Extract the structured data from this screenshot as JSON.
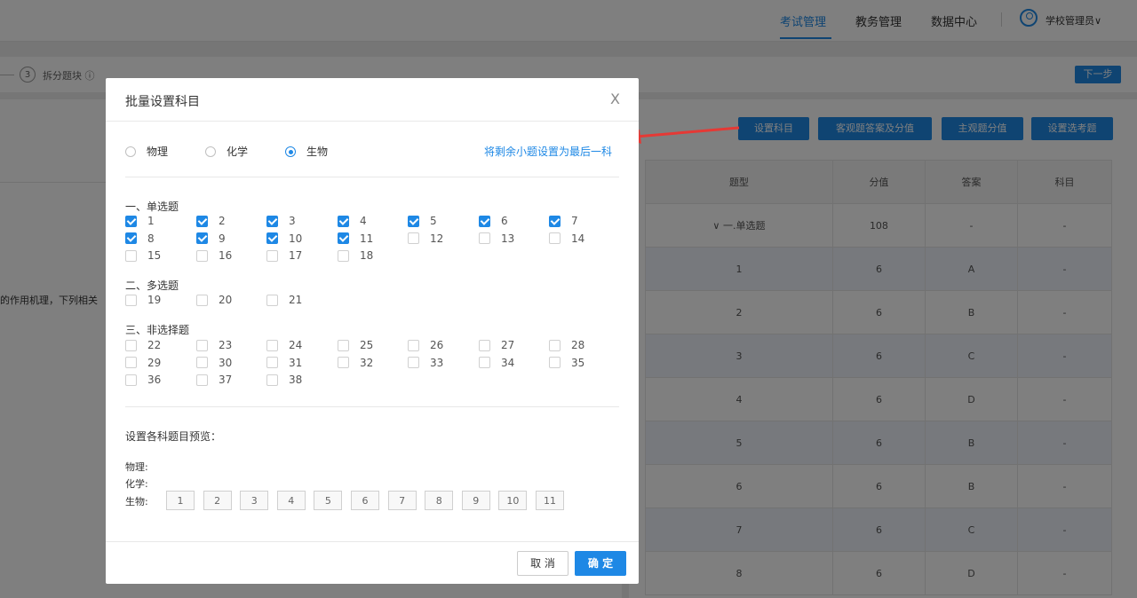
{
  "topnav": {
    "items": [
      "考试管理",
      "教务管理",
      "数据中心"
    ],
    "user_name": "学校管理员∨"
  },
  "stepbar": {
    "step_number": "3",
    "step_label": "拆分题块 ⓘ",
    "next_label": "下一步"
  },
  "left_panel": {
    "snippet": "的作用机理，下列相关"
  },
  "toolbar": {
    "buttons": [
      "设置科目",
      "客观题答案及分值",
      "主观题分值",
      "设置选考题"
    ]
  },
  "table": {
    "headers": [
      "题型",
      "分值",
      "答案",
      "科目"
    ],
    "group_row": {
      "type": "∨ 一.单选题",
      "score": "108",
      "answer": "-",
      "subject": "-"
    },
    "rows": [
      {
        "no": "1",
        "score": "6",
        "answer": "A",
        "subject": "-"
      },
      {
        "no": "2",
        "score": "6",
        "answer": "B",
        "subject": "-"
      },
      {
        "no": "3",
        "score": "6",
        "answer": "C",
        "subject": "-"
      },
      {
        "no": "4",
        "score": "6",
        "answer": "D",
        "subject": "-"
      },
      {
        "no": "5",
        "score": "6",
        "answer": "B",
        "subject": "-"
      },
      {
        "no": "6",
        "score": "6",
        "answer": "B",
        "subject": "-"
      },
      {
        "no": "7",
        "score": "6",
        "answer": "C",
        "subject": "-"
      },
      {
        "no": "8",
        "score": "6",
        "answer": "D",
        "subject": "-"
      }
    ]
  },
  "modal": {
    "title": "批量设置科目",
    "close": "X",
    "subjects": [
      "物理",
      "化学",
      "生物"
    ],
    "selected_subject": "生物",
    "set_last_link": "将剩余小题设置为最后一科",
    "sections": [
      {
        "title": "一、单选题",
        "items": [
          {
            "n": "1",
            "checked": true
          },
          {
            "n": "2",
            "checked": true
          },
          {
            "n": "3",
            "checked": true
          },
          {
            "n": "4",
            "checked": true
          },
          {
            "n": "5",
            "checked": true
          },
          {
            "n": "6",
            "checked": true
          },
          {
            "n": "7",
            "checked": true
          },
          {
            "n": "8",
            "checked": true
          },
          {
            "n": "9",
            "checked": true
          },
          {
            "n": "10",
            "checked": true
          },
          {
            "n": "11",
            "checked": true
          },
          {
            "n": "12",
            "checked": false
          },
          {
            "n": "13",
            "checked": false
          },
          {
            "n": "14",
            "checked": false
          },
          {
            "n": "15",
            "checked": false
          },
          {
            "n": "16",
            "checked": false
          },
          {
            "n": "17",
            "checked": false
          },
          {
            "n": "18",
            "checked": false
          }
        ]
      },
      {
        "title": "二、多选题",
        "items": [
          {
            "n": "19",
            "checked": false
          },
          {
            "n": "20",
            "checked": false
          },
          {
            "n": "21",
            "checked": false
          }
        ]
      },
      {
        "title": "三、非选择题",
        "items": [
          {
            "n": "22",
            "checked": false
          },
          {
            "n": "23",
            "checked": false
          },
          {
            "n": "24",
            "checked": false
          },
          {
            "n": "25",
            "checked": false
          },
          {
            "n": "26",
            "checked": false
          },
          {
            "n": "27",
            "checked": false
          },
          {
            "n": "28",
            "checked": false
          },
          {
            "n": "29",
            "checked": false
          },
          {
            "n": "30",
            "checked": false
          },
          {
            "n": "31",
            "checked": false
          },
          {
            "n": "32",
            "checked": false
          },
          {
            "n": "33",
            "checked": false
          },
          {
            "n": "34",
            "checked": false
          },
          {
            "n": "35",
            "checked": false
          },
          {
            "n": "36",
            "checked": false
          },
          {
            "n": "37",
            "checked": false
          },
          {
            "n": "38",
            "checked": false
          }
        ]
      }
    ],
    "preview_title": "设置各科题目预览：",
    "preview": [
      {
        "label": "物理:",
        "items": []
      },
      {
        "label": "化学:",
        "items": []
      },
      {
        "label": "生物:",
        "items": [
          "1",
          "2",
          "3",
          "4",
          "5",
          "6",
          "7",
          "8",
          "9",
          "10",
          "11"
        ]
      }
    ],
    "cancel_label": "取 消",
    "ok_label": "确 定"
  },
  "colors": {
    "accent": "#1e88e5",
    "arrow": "#e53935"
  }
}
